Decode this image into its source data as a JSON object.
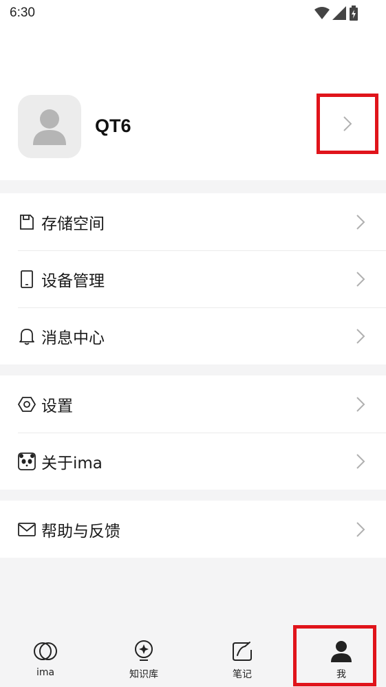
{
  "status_bar": {
    "time": "6:30"
  },
  "profile": {
    "name": "QT6"
  },
  "menu_groups": [
    {
      "items": [
        {
          "icon": "save-icon",
          "label": "存储空间"
        },
        {
          "icon": "tablet-icon",
          "label": "设备管理"
        },
        {
          "icon": "bell-icon",
          "label": "消息中心"
        }
      ]
    },
    {
      "items": [
        {
          "icon": "gear-icon",
          "label": "设置"
        },
        {
          "icon": "panda-icon",
          "label": "关于ima"
        }
      ]
    },
    {
      "items": [
        {
          "icon": "mail-icon",
          "label": "帮助与反馈"
        }
      ]
    }
  ],
  "bottom_nav": [
    {
      "icon": "ima-logo-icon",
      "label": "ima"
    },
    {
      "icon": "knowledge-base-icon",
      "label": "知识库"
    },
    {
      "icon": "note-icon",
      "label": "笔记"
    },
    {
      "icon": "person-icon",
      "label": "我",
      "active": true
    }
  ],
  "colors": {
    "highlight": "#e0141b",
    "background": "#f4f4f5"
  }
}
